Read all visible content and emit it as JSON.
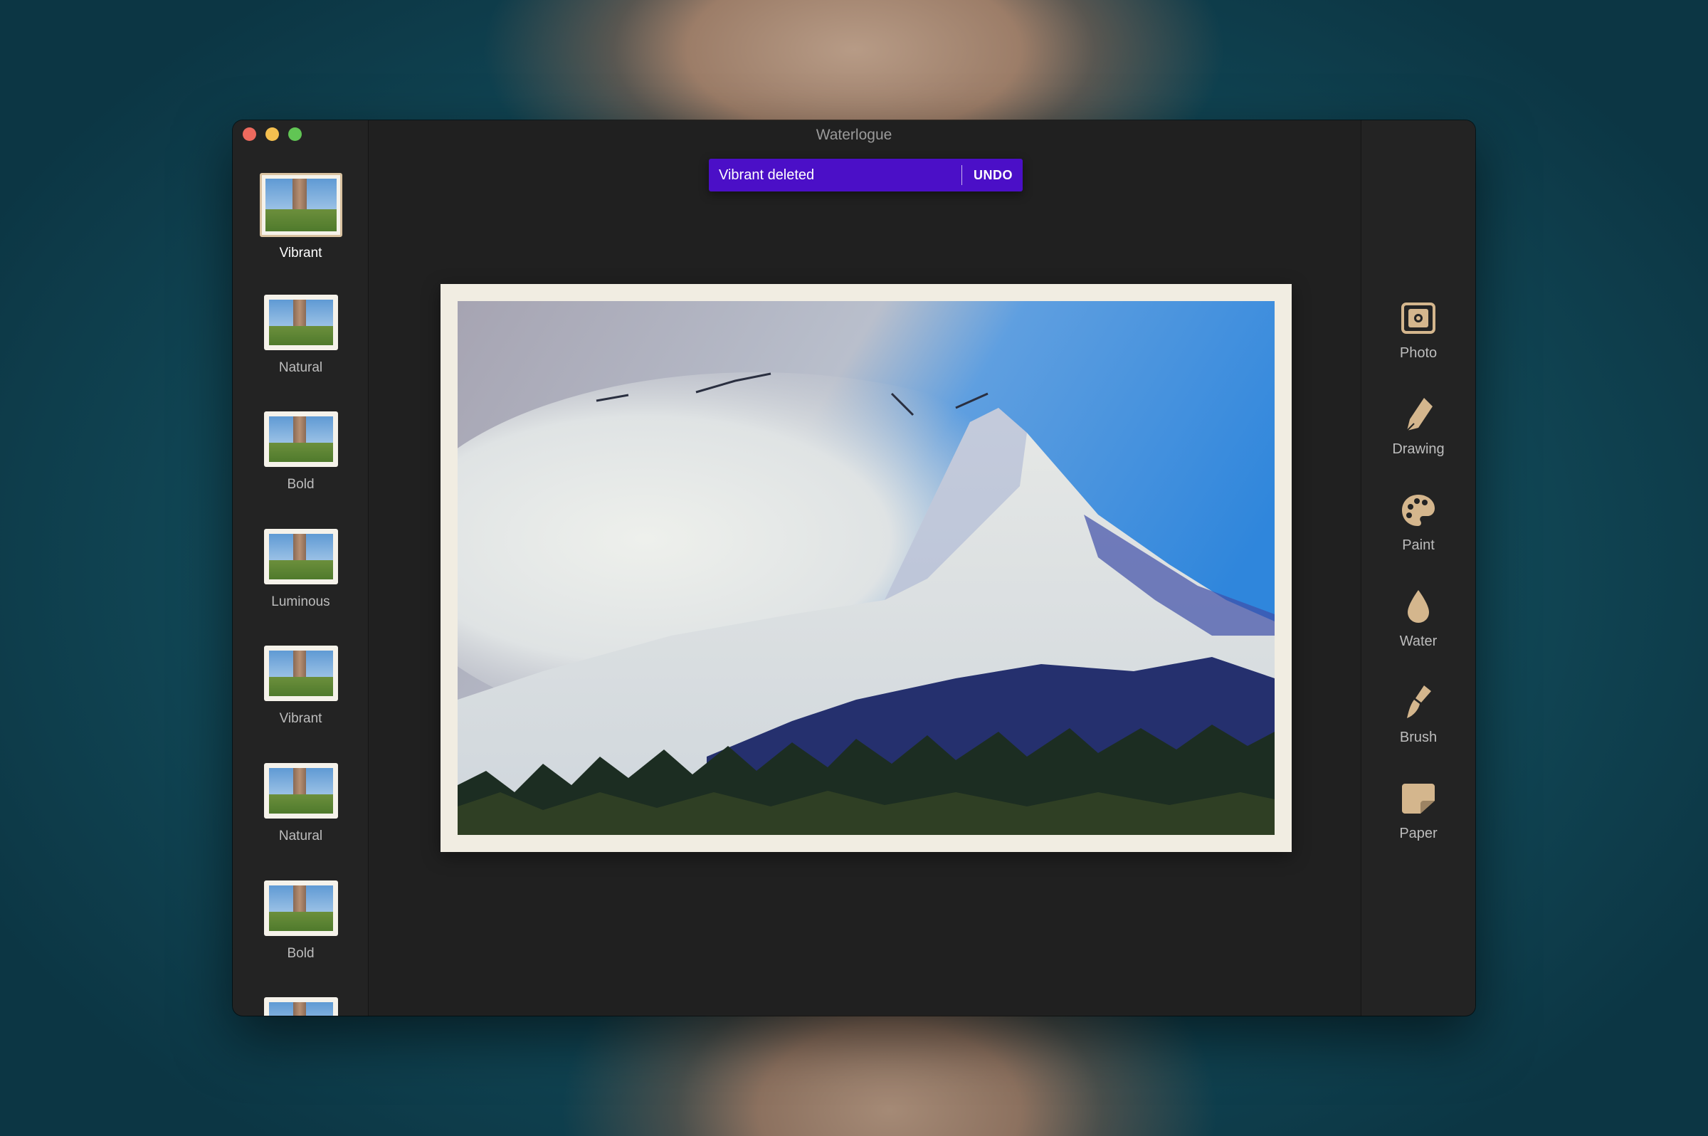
{
  "window": {
    "title": "Waterlogue"
  },
  "sidebar": {
    "presets": [
      {
        "label": "Vibrant",
        "selected": true
      },
      {
        "label": "Natural",
        "selected": false
      },
      {
        "label": "Bold",
        "selected": false
      },
      {
        "label": "Luminous",
        "selected": false
      },
      {
        "label": "Vibrant",
        "selected": false
      },
      {
        "label": "Natural",
        "selected": false
      },
      {
        "label": "Bold",
        "selected": false
      }
    ]
  },
  "snackbar": {
    "message": "Vibrant deleted",
    "action_label": "UNDO",
    "color": "#4b0fc7"
  },
  "toolbar": {
    "tools": [
      {
        "label": "Photo",
        "icon": "photo-icon"
      },
      {
        "label": "Drawing",
        "icon": "pen-nib-icon"
      },
      {
        "label": "Paint",
        "icon": "palette-icon"
      },
      {
        "label": "Water",
        "icon": "water-drop-icon"
      },
      {
        "label": "Brush",
        "icon": "brush-icon"
      },
      {
        "label": "Paper",
        "icon": "paper-icon"
      }
    ],
    "accent_color": "#d4b68d"
  }
}
